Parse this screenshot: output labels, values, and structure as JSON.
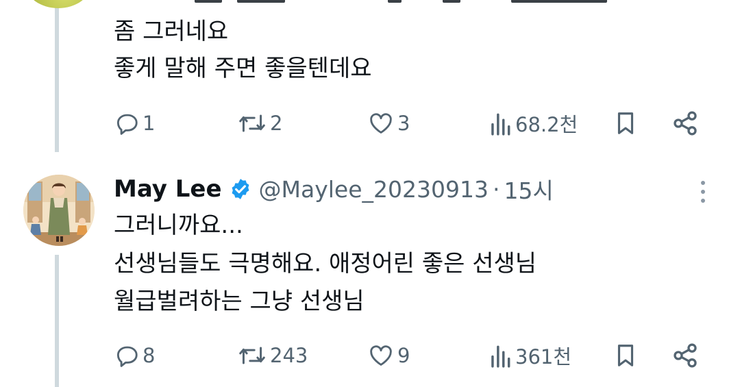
{
  "reply1": {
    "lines": [
      "좀 그러네요",
      "좋게 말해 주면 좋을텐데요"
    ],
    "actions": {
      "reply_count": "1",
      "repost_count": "2",
      "like_count": "3",
      "views": "68.2천"
    }
  },
  "reply2": {
    "author": {
      "display_name": "May Lee",
      "verified": true,
      "handle": "@Maylee_20230913",
      "separator": "·",
      "time": "15시"
    },
    "lines": [
      "그러니까요...",
      "선생님들도 극명해요. 애정어린 좋은 선생님",
      "월급벌려하는 그냥 선생님"
    ],
    "actions": {
      "reply_count": "8",
      "repost_count": "243",
      "like_count": "9",
      "views": "361천"
    }
  },
  "icons": {
    "reply": "speech-bubble-icon",
    "repost": "repost-arrows-icon",
    "like": "heart-icon",
    "views": "bar-chart-icon",
    "bookmark": "bookmark-icon",
    "share": "share-icon",
    "more": "more-vertical-icon",
    "verified": "verified-badge-icon"
  },
  "colors": {
    "text": "#0f1419",
    "secondary": "#536471",
    "verified": "#1d9bf0",
    "thread_line": "#cfd9de"
  }
}
